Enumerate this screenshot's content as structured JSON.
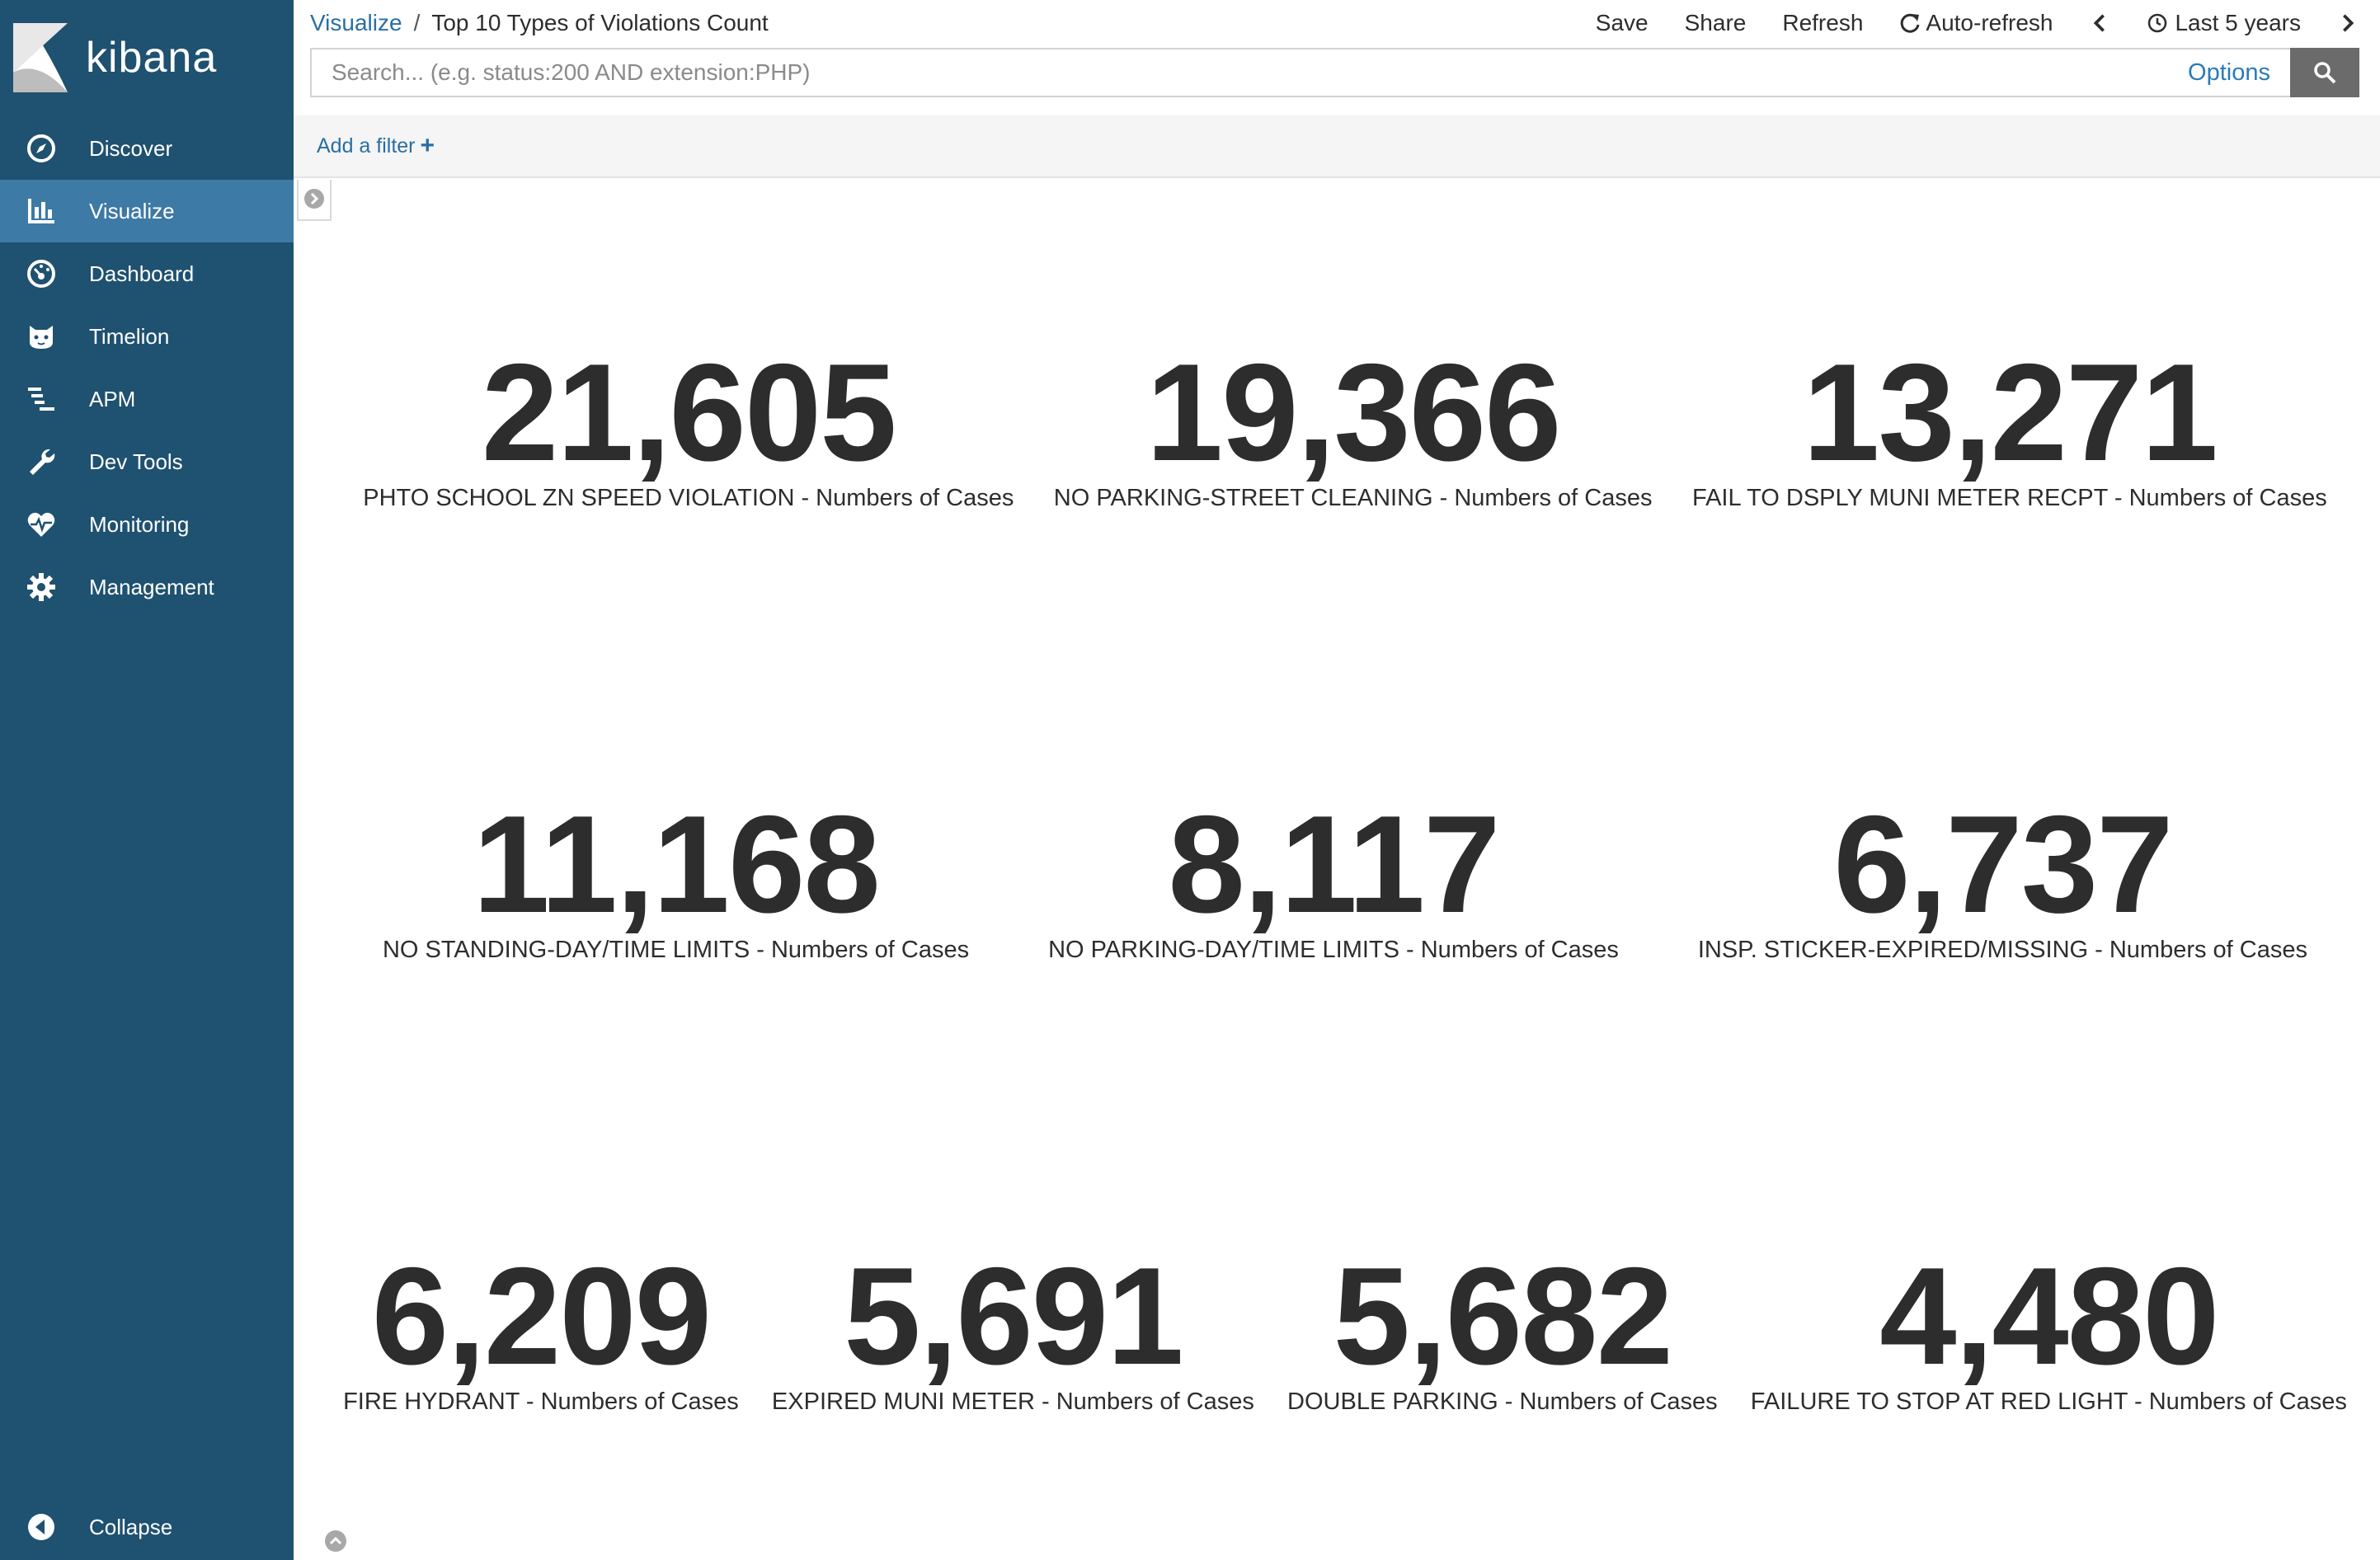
{
  "app": {
    "brand": "kibana"
  },
  "sidebar": {
    "items": [
      {
        "label": "Discover",
        "icon": "compass-icon"
      },
      {
        "label": "Visualize",
        "icon": "bar-chart-icon",
        "active": true
      },
      {
        "label": "Dashboard",
        "icon": "dashboard-gauge-icon"
      },
      {
        "label": "Timelion",
        "icon": "timelion-cat-icon"
      },
      {
        "label": "APM",
        "icon": "apm-icon"
      },
      {
        "label": "Dev Tools",
        "icon": "wrench-icon"
      },
      {
        "label": "Monitoring",
        "icon": "heartbeat-icon"
      },
      {
        "label": "Management",
        "icon": "gear-icon"
      }
    ],
    "collapse_label": "Collapse"
  },
  "breadcrumb": {
    "parent": "Visualize",
    "separator": "/",
    "current": "Top 10 Types of Violations Count"
  },
  "toolbar": {
    "save": "Save",
    "share": "Share",
    "refresh": "Refresh",
    "auto_refresh": "Auto-refresh",
    "time_range": "Last 5 years"
  },
  "search": {
    "placeholder": "Search... (e.g. status:200 AND extension:PHP)",
    "value": "",
    "options_label": "Options"
  },
  "filters": {
    "add_label": "Add a filter",
    "plus": "+"
  },
  "metrics": [
    {
      "value": "21,605",
      "label": "PHTO SCHOOL ZN SPEED VIOLATION - Numbers of Cases"
    },
    {
      "value": "19,366",
      "label": "NO PARKING-STREET CLEANING - Numbers of Cases"
    },
    {
      "value": "13,271",
      "label": "FAIL TO DSPLY MUNI METER RECPT - Numbers of Cases"
    },
    {
      "value": "11,168",
      "label": "NO STANDING-DAY/TIME LIMITS - Numbers of Cases"
    },
    {
      "value": "8,117",
      "label": "NO PARKING-DAY/TIME LIMITS - Numbers of Cases"
    },
    {
      "value": "6,737",
      "label": "INSP. STICKER-EXPIRED/MISSING - Numbers of Cases"
    },
    {
      "value": "6,209",
      "label": "FIRE HYDRANT - Numbers of Cases"
    },
    {
      "value": "5,691",
      "label": "EXPIRED MUNI METER - Numbers of Cases"
    },
    {
      "value": "5,682",
      "label": "DOUBLE PARKING - Numbers of Cases"
    },
    {
      "value": "4,480",
      "label": "FAILURE TO STOP AT RED LIGHT - Numbers of Cases"
    }
  ],
  "colors": {
    "sidebar_bg": "#1f5170",
    "sidebar_active": "#3d7aa5",
    "link": "#2a6fa3",
    "metric_text": "#2d2d2d"
  }
}
